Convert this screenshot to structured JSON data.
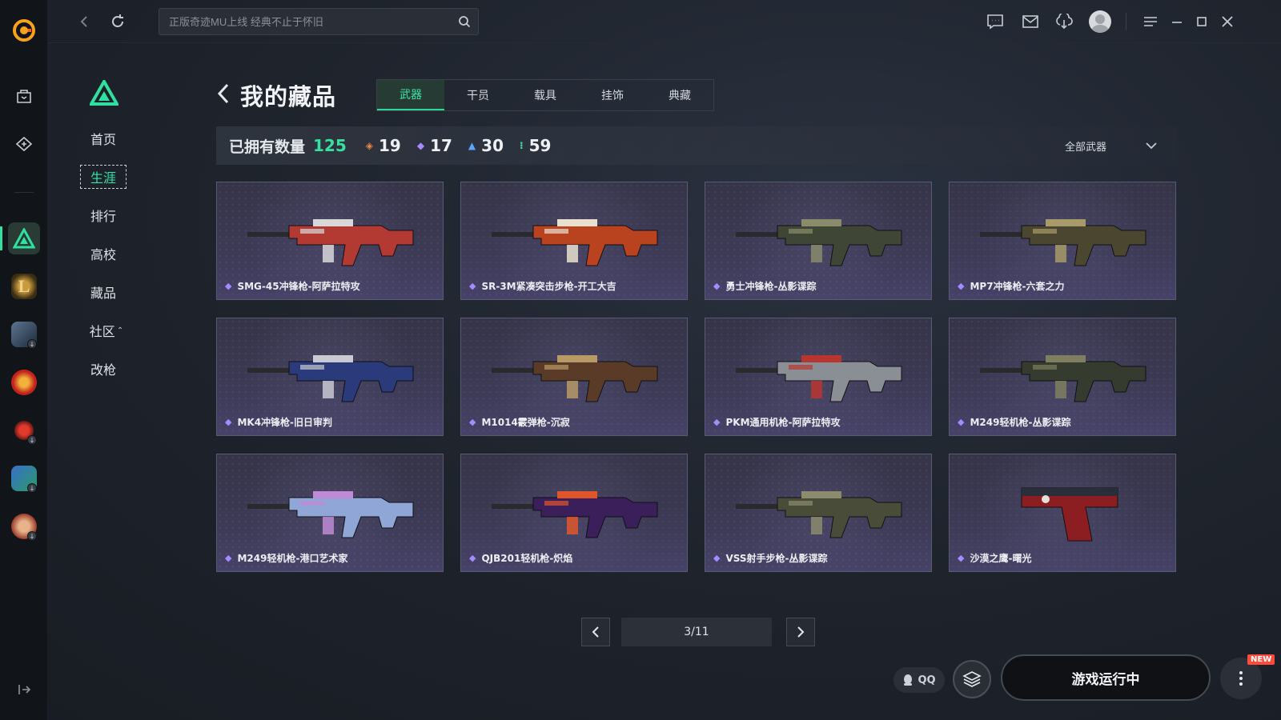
{
  "colors": {
    "accent": "#2fe0a0",
    "rare_purple": "#a58bff",
    "bg": "#1f242d"
  },
  "search": {
    "placeholder": "正版奇迹MU上线 经典不止于怀旧"
  },
  "rail": {
    "items": [
      {
        "icon": "app-logo-icon"
      },
      {
        "icon": "shop-bag-icon"
      },
      {
        "icon": "game-tag-icon"
      },
      {
        "icon": "delta-game-icon"
      },
      {
        "icon": "league-game-icon"
      },
      {
        "icon": "mech-game-icon"
      },
      {
        "icon": "cf-game-icon"
      },
      {
        "icon": "red-game-icon"
      },
      {
        "icon": "blue-game-icon"
      },
      {
        "icon": "fighter-game-icon"
      }
    ]
  },
  "secondary_nav": {
    "items": [
      {
        "label": "首页"
      },
      {
        "label": "生涯",
        "active": true
      },
      {
        "label": "排行"
      },
      {
        "label": "高校"
      },
      {
        "label": "藏品"
      },
      {
        "label": "社区"
      },
      {
        "label": "改枪"
      }
    ],
    "community_caret": "⌃"
  },
  "header": {
    "title": "我的藏品",
    "tabs": [
      {
        "label": "武器",
        "active": true
      },
      {
        "label": "干员"
      },
      {
        "label": "载具"
      },
      {
        "label": "挂饰"
      },
      {
        "label": "典藏"
      }
    ]
  },
  "stats": {
    "owned_label": "已拥有数量",
    "owned_count": "125",
    "tiers": [
      {
        "value": "19",
        "color": "#e8894a",
        "glyph": "◈"
      },
      {
        "value": "17",
        "color": "#a58bff",
        "glyph": "◆"
      },
      {
        "value": "30",
        "color": "#5aa6ff",
        "glyph": "▲"
      },
      {
        "value": "59",
        "color": "#3fe6a8",
        "glyph": "⁝"
      }
    ],
    "filter_label": "全部武器"
  },
  "items": [
    {
      "name": "SMG-45冲锋枪-阿萨拉特攻",
      "color": "#b33a32",
      "accent": "#d8d8d8"
    },
    {
      "name": "SR-3M紧凑突击步枪-开工大吉",
      "color": "#b8431e",
      "accent": "#e9e0d0"
    },
    {
      "name": "勇士冲锋枪-丛影谍踪",
      "color": "#3f4636",
      "accent": "#8a8b6b"
    },
    {
      "name": "MP7冲锋枪-六套之力",
      "color": "#4a4630",
      "accent": "#a89a6a"
    },
    {
      "name": "MK4冲锋枪-旧日审判",
      "color": "#2a3a7a",
      "accent": "#c9c9d2"
    },
    {
      "name": "M1014霰弹枪-沉寂",
      "color": "#5a3b28",
      "accent": "#b89a66"
    },
    {
      "name": "PKM通用机枪-阿萨拉特攻",
      "color": "#8a8e95",
      "accent": "#b8362f"
    },
    {
      "name": "M249轻机枪-丛影谍踪",
      "color": "#353b2e",
      "accent": "#7f7f60"
    },
    {
      "name": "M249轻机枪-港口艺术家",
      "color": "#8fa6d6",
      "accent": "#c08ad6"
    },
    {
      "name": "QJB201轻机枪-炽焰",
      "color": "#3a1f5a",
      "accent": "#e0562a"
    },
    {
      "name": "VSS射手步枪-丛影谍踪",
      "color": "#4a4c3a",
      "accent": "#8c8b6e"
    },
    {
      "name": "沙漠之鹰-曙光",
      "color": "#8c1e22",
      "accent": "#2b2e3a"
    }
  ],
  "pagination": {
    "label": "3/11"
  },
  "bottom": {
    "qq_label": "QQ",
    "run_label": "游戏运行中",
    "new_badge": "NEW"
  }
}
